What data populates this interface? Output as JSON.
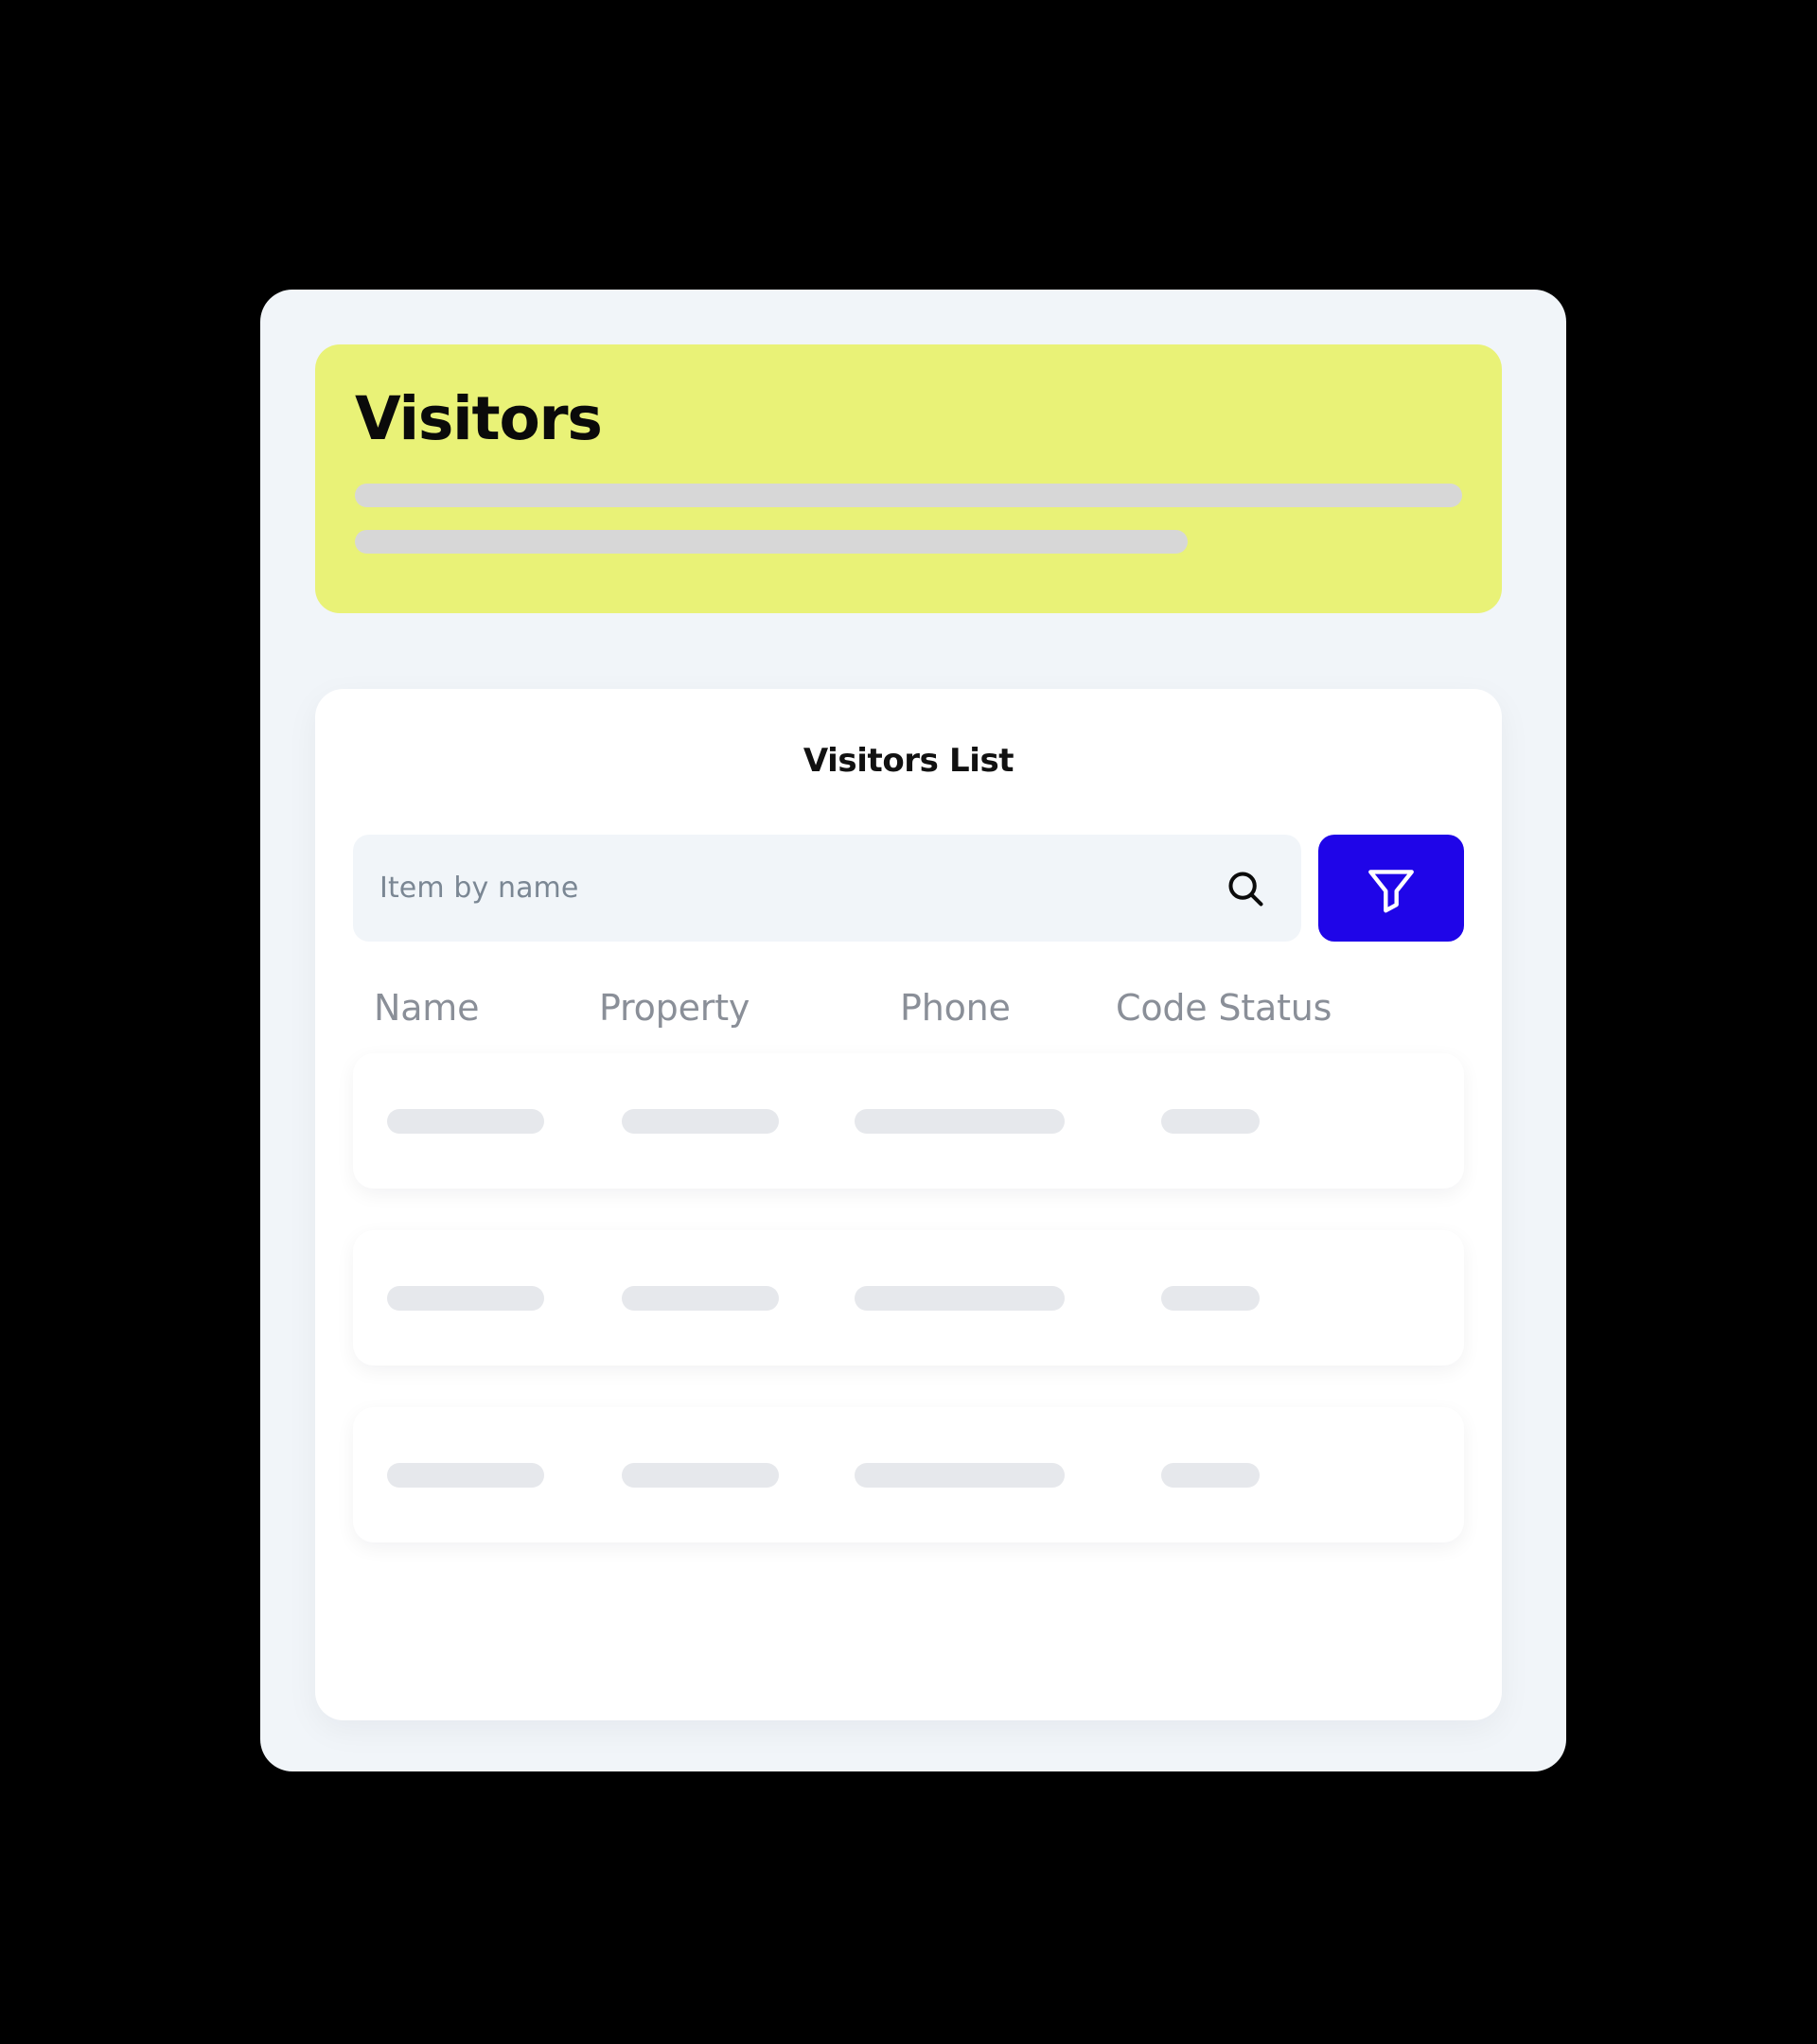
{
  "colors": {
    "page_background": "#000000",
    "shell_background": "#f1f5f9",
    "hero_yellow": "#e9f277",
    "filter_blue": "#1f05e8",
    "card_white": "#ffffff",
    "skeleton_grey_hero": "#d7d7d7",
    "skeleton_grey_row": "#e6e8ec",
    "header_text_grey": "#8a8f98",
    "placeholder_grey": "#7b8794",
    "title_black": "#0a0a0a"
  },
  "hero": {
    "title": "Visitors",
    "skeleton_bars": [
      {
        "name": "hero-skeleton-bar-1",
        "width_pct": 100
      },
      {
        "name": "hero-skeleton-bar-2",
        "width_pct": 75
      }
    ]
  },
  "list_card": {
    "title": "Visitors List",
    "search": {
      "placeholder": "Item by name",
      "value": "",
      "icon": "search-icon"
    },
    "filter_button": {
      "label": "",
      "icon": "filter-funnel-icon"
    },
    "columns": [
      {
        "key": "name",
        "label": "Name"
      },
      {
        "key": "property",
        "label": "Property"
      },
      {
        "key": "phone",
        "label": "Phone"
      },
      {
        "key": "code_status",
        "label": "Code Status"
      }
    ],
    "rows": [
      {
        "name": "table-row",
        "loading": true,
        "cells": [
          {
            "column": "name",
            "value": "",
            "skeleton_width": 166
          },
          {
            "column": "property",
            "value": "",
            "skeleton_width": 166
          },
          {
            "column": "phone",
            "value": "",
            "skeleton_width": 222
          },
          {
            "column": "code_status",
            "value": "",
            "skeleton_width": 104
          }
        ]
      },
      {
        "name": "table-row",
        "loading": true,
        "cells": [
          {
            "column": "name",
            "value": "",
            "skeleton_width": 166
          },
          {
            "column": "property",
            "value": "",
            "skeleton_width": 166
          },
          {
            "column": "phone",
            "value": "",
            "skeleton_width": 222
          },
          {
            "column": "code_status",
            "value": "",
            "skeleton_width": 104
          }
        ]
      },
      {
        "name": "table-row",
        "loading": true,
        "cells": [
          {
            "column": "name",
            "value": "",
            "skeleton_width": 166
          },
          {
            "column": "property",
            "value": "",
            "skeleton_width": 222
          },
          {
            "column": "phone",
            "value": "",
            "skeleton_width": 222
          },
          {
            "column": "code_status",
            "value": "",
            "skeleton_width": 104
          }
        ]
      }
    ]
  }
}
